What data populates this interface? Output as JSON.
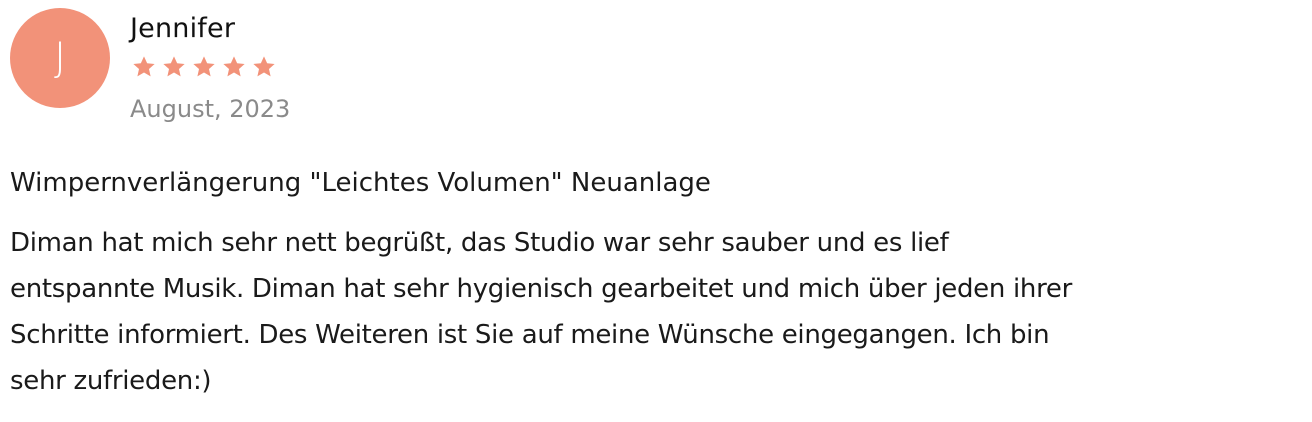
{
  "review": {
    "avatar_initial": "J",
    "author_name": "Jennifer",
    "rating": 5,
    "rating_max": 5,
    "date": "August, 2023",
    "service_title": "Wimpernverlängerung \"Leichtes Volumen\" Neuanlage",
    "body_lines": [
      "Diman hat mich sehr nett begrüßt, das Studio war sehr sauber und es lief",
      "entspannte Musik. Diman hat sehr hygienisch gearbeitet und mich über jeden ihrer",
      "Schritte informiert. Des Weiteren ist Sie auf meine Wünsche eingegangen. Ich bin",
      "sehr zufrieden:)"
    ]
  },
  "icons": {
    "star": "star-icon"
  },
  "colors": {
    "avatar_bg": "#f29279",
    "star": "#f29279",
    "date_text": "#8a8a8a",
    "body_text": "#1a1a1a"
  }
}
